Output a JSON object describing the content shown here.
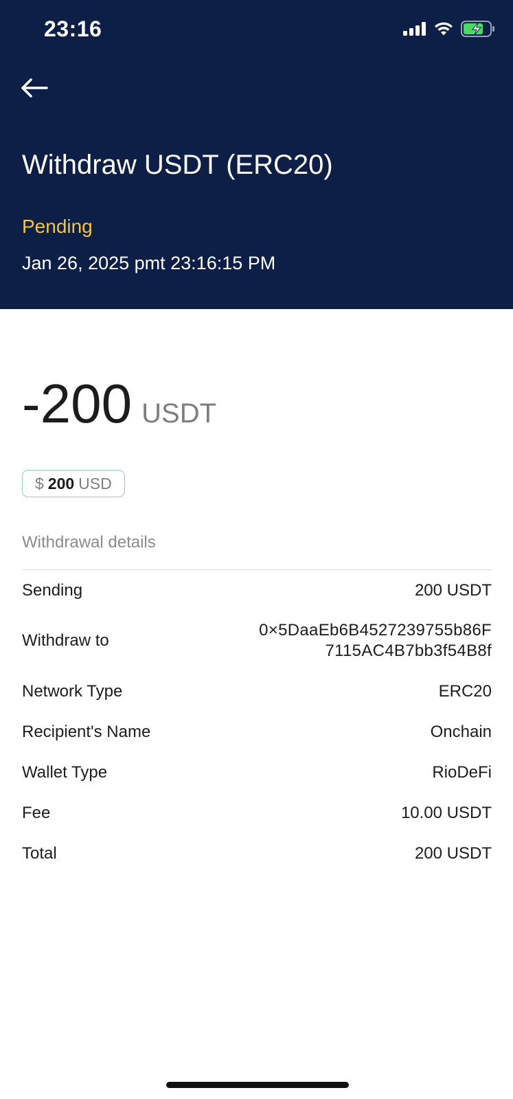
{
  "status_bar": {
    "time": "23:16",
    "icons": [
      "signal-icon",
      "wifi-icon",
      "battery-charging-icon"
    ]
  },
  "header": {
    "back_icon": "arrow-left-icon",
    "title": "Withdraw USDT (ERC20)",
    "status": "Pending",
    "date": "Jan 26, 2025 pmt 23:16:15 PM"
  },
  "amount": {
    "value": "-200",
    "unit": "USDT"
  },
  "usd_chip": {
    "symbol": "$",
    "value": "200",
    "currency": "USD"
  },
  "details": {
    "section_label": "Withdrawal details",
    "rows": [
      {
        "label": "Sending",
        "value": "200 USDT"
      },
      {
        "label": "Withdraw to",
        "value_line1": "0×5DaaEb6B4527239755b86F",
        "value_line2": "7115AC4B7bb3f54B8f"
      },
      {
        "label": "Network Type",
        "value": "ERC20"
      },
      {
        "label": "Recipient's Name",
        "value": "Onchain"
      },
      {
        "label": "Wallet Type",
        "value": "RioDeFi"
      },
      {
        "label": "Fee",
        "value": "10.00 USDT"
      },
      {
        "label": "Total",
        "value": "200 USDT"
      }
    ]
  },
  "colors": {
    "header_bg": "#0d1f47",
    "pending": "#f5c542",
    "chip_border": "#8fd0c3",
    "battery_green": "#4cd964"
  }
}
